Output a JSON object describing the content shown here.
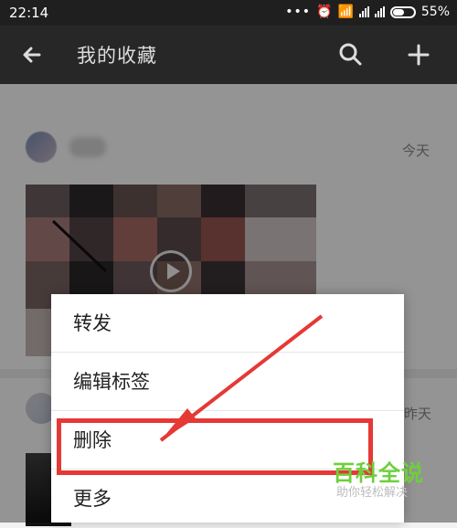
{
  "status": {
    "time": "22:14",
    "battery": "55%",
    "battery_level": 0.55
  },
  "header": {
    "title": "我的收藏"
  },
  "items": [
    {
      "date": "今天"
    },
    {
      "date": "昨天"
    }
  ],
  "menu": {
    "forward": "转发",
    "edit_tags": "编辑标签",
    "delete": "删除",
    "more": "更多"
  },
  "watermark": {
    "main": "百科全说",
    "sub": "助你轻松解决"
  },
  "colors": {
    "status_bar": "#1f1f1f",
    "app_bar": "#272727",
    "highlight": "#e53935",
    "watermark_green": "#6dd03b"
  },
  "icons": {
    "back": "back-arrow-icon",
    "search": "search-icon",
    "add": "plus-icon",
    "play": "play-icon",
    "wifi": "wifi-icon",
    "alarm": "alarm-icon",
    "signal": "signal-icon",
    "battery": "battery-icon"
  }
}
